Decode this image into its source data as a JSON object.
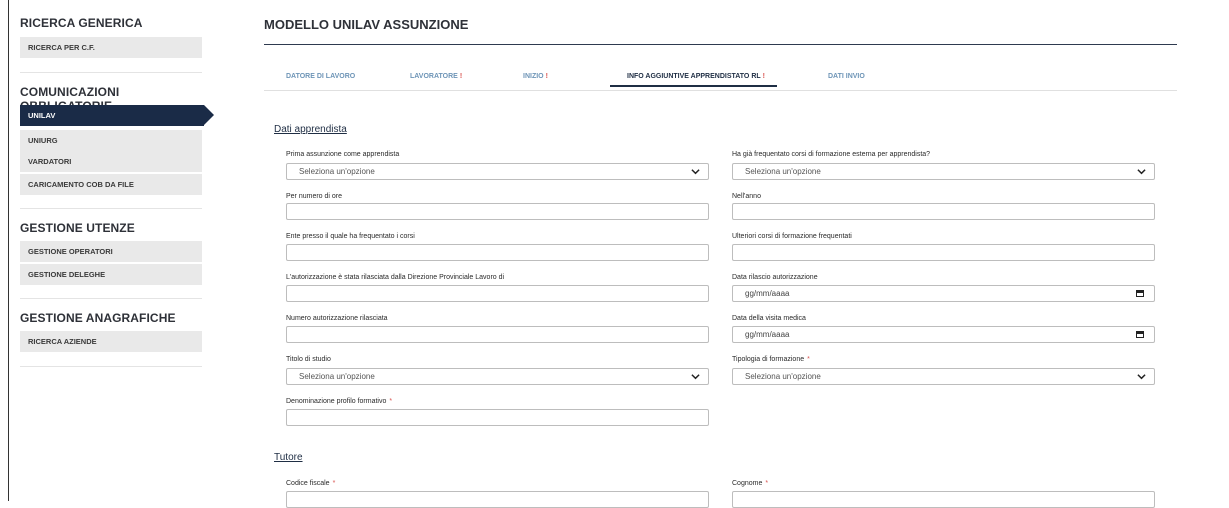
{
  "sidebar": {
    "sections": [
      {
        "title": "RICERCA GENERICA",
        "items": [
          "RICERCA PER C.F."
        ]
      },
      {
        "title": "COMUNICAZIONI OBBLIGATORIE",
        "items": [
          "UNILAV",
          "UNIURG",
          "VARDATORI",
          "CARICAMENTO COB DA FILE"
        ]
      },
      {
        "title": "GESTIONE UTENZE",
        "items": [
          "GESTIONE OPERATORI",
          "GESTIONE DELEGHE"
        ]
      },
      {
        "title": "GESTIONE ANAGRAFICHE",
        "items": [
          "RICERCA AZIENDE"
        ]
      }
    ],
    "active_item": "UNILAV"
  },
  "page": {
    "title": "MODELLO UNILAV ASSUNZIONE"
  },
  "tabs": [
    {
      "label": "DATORE DI LAVORO",
      "mark": ""
    },
    {
      "label": "LAVORATORE",
      "mark": "!"
    },
    {
      "label": "INIZIO",
      "mark": "!"
    },
    {
      "label": "INFO AGGIUNTIVE APPRENDISTATO RL",
      "mark": "!"
    },
    {
      "label": "DATI INVIO",
      "mark": ""
    }
  ],
  "active_tab": "INFO AGGIUNTIVE APPRENDISTATO RL",
  "sections": {
    "apprendista": "Dati apprendista",
    "tutore": "Tutore"
  },
  "fields": {
    "prima_assunzione": {
      "label": "Prima assunzione come apprendista",
      "value": "Seleziona un'opzione"
    },
    "corsi_esterni": {
      "label": "Ha già frequentato corsi di formazione esterna per apprendista?",
      "value": "Seleziona un'opzione"
    },
    "numero_ore": {
      "label": "Per numero di ore",
      "value": ""
    },
    "anno": {
      "label": "Nell'anno",
      "value": ""
    },
    "ente": {
      "label": "Ente presso il quale ha frequentato i corsi",
      "value": ""
    },
    "ulteriori_corsi": {
      "label": "Ulteriori corsi di formazione frequentati",
      "value": ""
    },
    "autorizzazione_dpl": {
      "label": "L'autorizzazione è stata rilasciata dalla Direzione Provinciale Lavoro di",
      "value": ""
    },
    "data_rilascio": {
      "label": "Data rilascio autorizzazione",
      "placeholder": "gg/mm/aaaa"
    },
    "numero_autorizzazione": {
      "label": "Numero autorizzazione rilasciata",
      "value": ""
    },
    "data_visita": {
      "label": "Data della visita medica",
      "placeholder": "gg/mm/aaaa"
    },
    "titolo_studio": {
      "label": "Titolo di studio",
      "value": "Seleziona un'opzione"
    },
    "tipologia_formazione": {
      "label": "Tipologia di formazione",
      "value": "Seleziona un'opzione",
      "required": "*"
    },
    "profilo_formativo": {
      "label": "Denominazione profilo formativo",
      "value": "",
      "required": "*"
    },
    "codice_fiscale": {
      "label": "Codice fiscale",
      "value": "",
      "required": "*"
    },
    "cognome": {
      "label": "Cognome",
      "value": "",
      "required": "*"
    }
  },
  "colors": {
    "navy": "#1a2b47",
    "tab_blue": "#6e95b7",
    "required_red": "#d9534f",
    "sidebar_gray": "#e9e9e9"
  }
}
